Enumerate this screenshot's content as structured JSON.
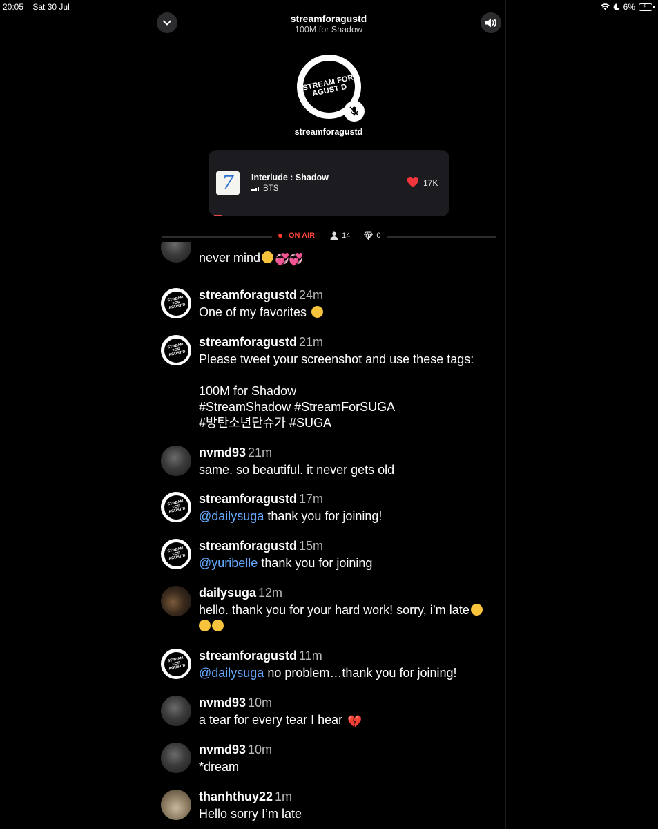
{
  "status_bar": {
    "time": "20:05",
    "date": "Sat 30 Jul",
    "battery_percent": "6%"
  },
  "header": {
    "title": "streamforagustd",
    "subtitle": "100M for Shadow"
  },
  "host": {
    "name": "streamforagustd",
    "logo_line1": "STREAM FOR",
    "logo_line2": "AGUST D"
  },
  "now_playing": {
    "album_mark": "7",
    "title": "Interlude : Shadow",
    "artist": "BTS",
    "likes": "17K"
  },
  "live": {
    "status": "ON AIR",
    "listeners": "14",
    "diamonds": "0"
  },
  "colors": {
    "background": "#000000",
    "on_air": "#ff453a",
    "mention": "#64a8ff",
    "card": "#1c1c20"
  },
  "messages": [
    {
      "user": "",
      "time": "",
      "text": "never mind",
      "avatar": "nvmd93"
    },
    {
      "user": "streamforagustd",
      "time": "24m",
      "text": "One of my favorites",
      "avatar": "streamforagustd"
    },
    {
      "user": "streamforagustd",
      "time": "21m",
      "text": "Please tweet your screenshot and use these tags:\n\n100M for Shadow\n#StreamShadow #StreamForSUGA\n#방탄소년단슈가 #SUGA",
      "avatar": "streamforagustd"
    },
    {
      "user": "nvmd93",
      "time": "21m",
      "text": "same. so beautiful. it never gets old",
      "avatar": "nvmd93"
    },
    {
      "user": "streamforagustd",
      "time": "17m",
      "mention": "@dailysuga",
      "text": " thank you for joining!",
      "avatar": "streamforagustd"
    },
    {
      "user": "streamforagustd",
      "time": "15m",
      "mention": "@yuribelle",
      "text": " thank you for joining",
      "avatar": "streamforagustd"
    },
    {
      "user": "dailysuga",
      "time": "12m",
      "text": "hello. thank you for your hard work! sorry, i’m late",
      "avatar": "dailysuga"
    },
    {
      "user": "streamforagustd",
      "time": "11m",
      "mention": "@dailysuga",
      "text": " no problem…thank you for joining!",
      "avatar": "streamforagustd"
    },
    {
      "user": "nvmd93",
      "time": "10m",
      "text": "a tear for every tear I hear",
      "avatar": "nvmd93"
    },
    {
      "user": "nvmd93",
      "time": "10m",
      "text": "*dream",
      "avatar": "nvmd93"
    },
    {
      "user": "thanhthuy22",
      "time": "1m",
      "text": "Hello sorry I’m late",
      "avatar": "thanhthuy22"
    }
  ]
}
